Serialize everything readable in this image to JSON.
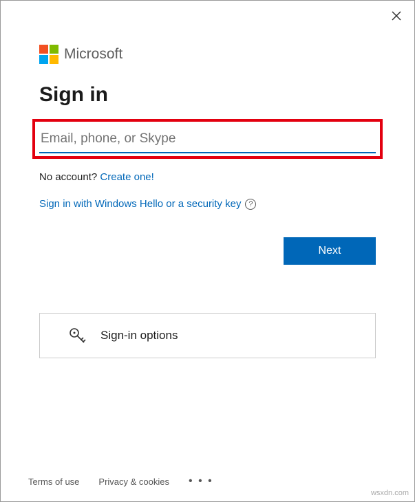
{
  "brand": "Microsoft",
  "heading": "Sign in",
  "input": {
    "placeholder": "Email, phone, or Skype",
    "value": ""
  },
  "no_account": {
    "text": "No account?",
    "link": "Create one!"
  },
  "hello_link": "Sign in with Windows Hello or a security key",
  "next_button": "Next",
  "signin_options": "Sign-in options",
  "footer": {
    "terms": "Terms of use",
    "privacy": "Privacy & cookies"
  },
  "watermark": "wsxdn.com"
}
